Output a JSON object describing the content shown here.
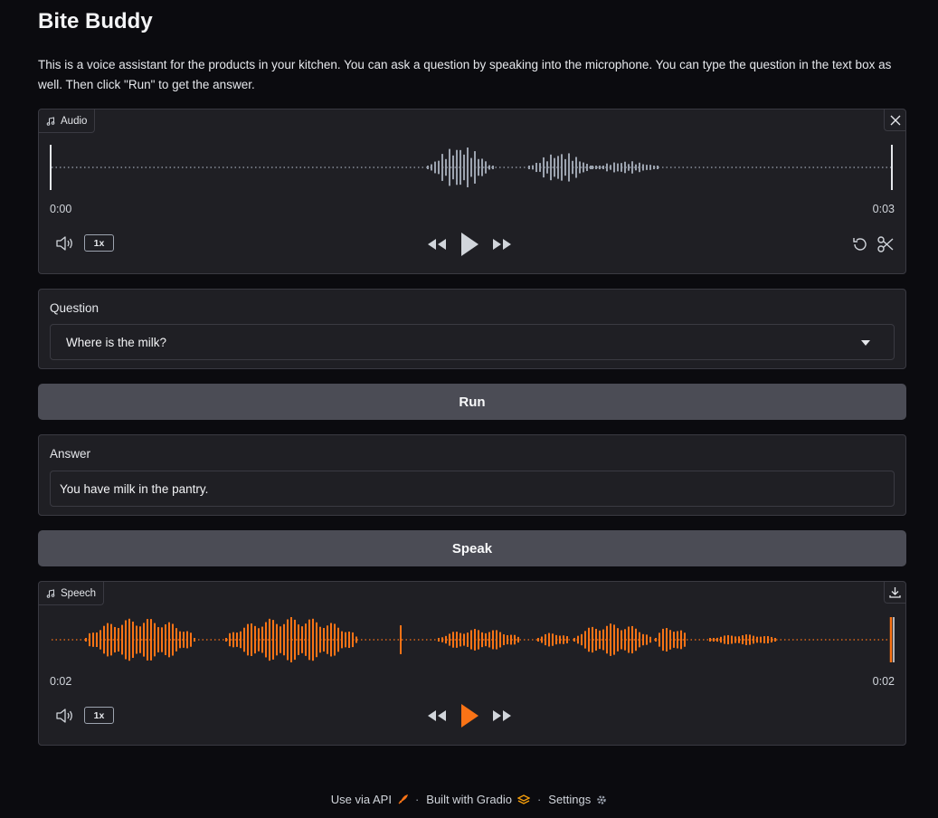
{
  "app": {
    "title": "Bite Buddy",
    "description": "This is a voice assistant for the products in your kitchen. You can ask a question by speaking into the microphone. You can type the question in the text box as well. Then click \"Run\" to get the answer."
  },
  "audio_input": {
    "label": "Audio",
    "time_start": "0:00",
    "time_end": "0:03",
    "speed": "1x",
    "icons": [
      "music-note-icon",
      "close-icon",
      "volume-icon",
      "rewind-icon",
      "play-icon",
      "fast-forward-icon",
      "undo-icon",
      "scissors-icon"
    ],
    "color": "#9ca3af"
  },
  "question": {
    "label": "Question",
    "value": "Where is the milk?"
  },
  "run_button": {
    "label": "Run"
  },
  "answer": {
    "label": "Answer",
    "value": "You have milk in the pantry."
  },
  "speak_button": {
    "label": "Speak"
  },
  "speech_output": {
    "label": "Speech",
    "time_start": "0:02",
    "time_end": "0:02",
    "speed": "1x",
    "icons": [
      "music-note-icon",
      "download-icon",
      "volume-icon",
      "rewind-icon",
      "play-icon",
      "fast-forward-icon"
    ],
    "color": "#f97316"
  },
  "footer": {
    "api": "Use via API",
    "built": "Built with Gradio",
    "settings": "Settings",
    "separator": "·"
  }
}
